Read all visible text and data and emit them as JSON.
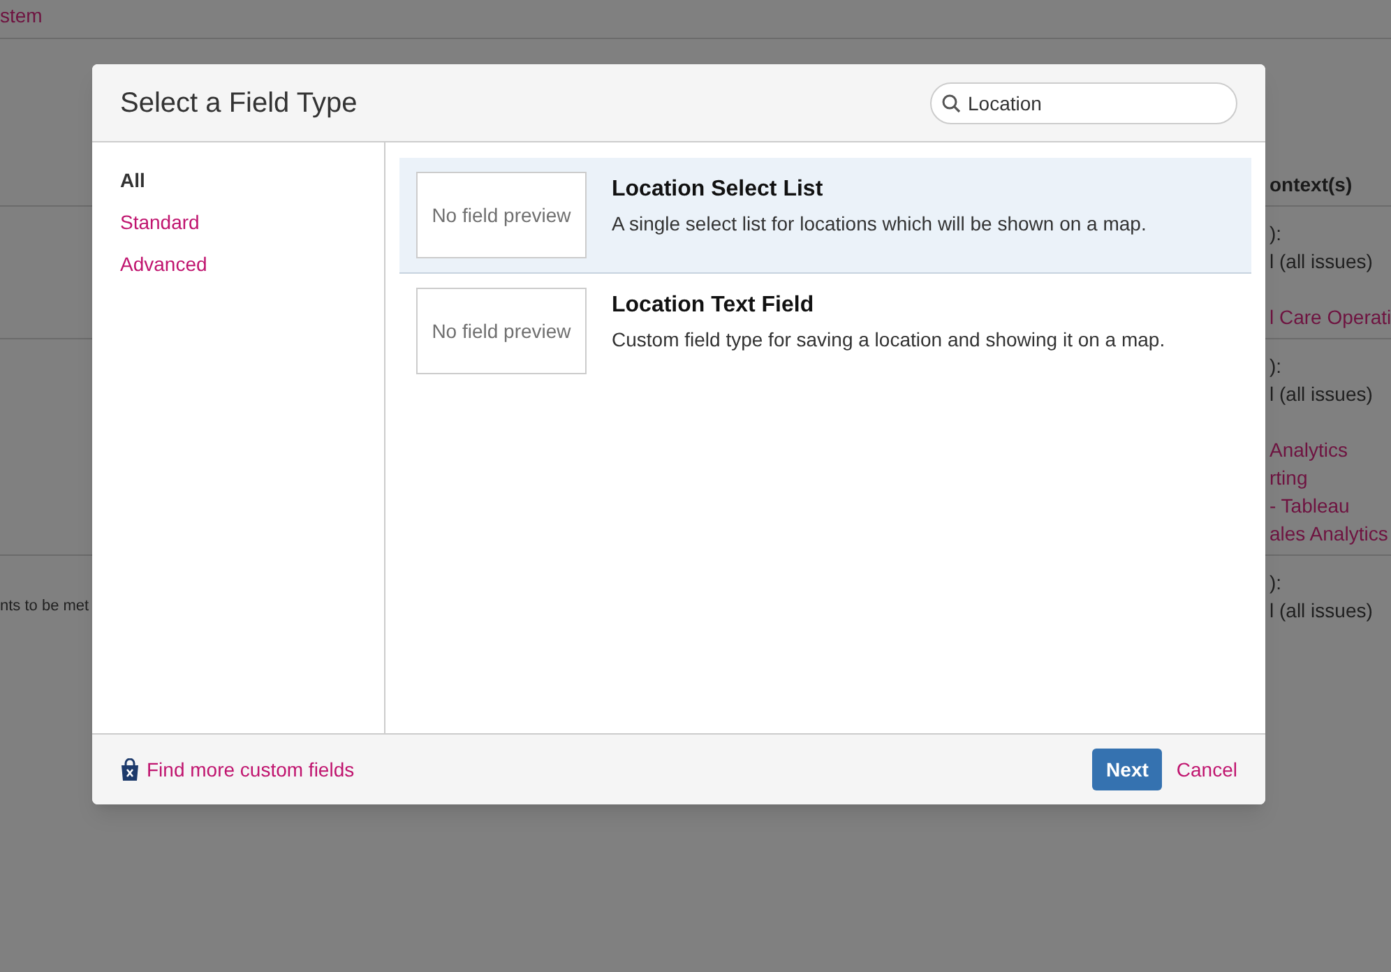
{
  "background": {
    "texts": [
      {
        "text": "stem",
        "kind": "link"
      },
      {
        "text": "nts to be met",
        "kind": "plain"
      },
      {
        "text": "ontext(s)",
        "kind": "heading"
      },
      {
        "text": "):",
        "kind": "plain"
      },
      {
        "text": "l (all issues)",
        "kind": "plain"
      },
      {
        "text": "l Care Operati",
        "kind": "link"
      },
      {
        "text": "):",
        "kind": "plain"
      },
      {
        "text": "l (all issues)",
        "kind": "plain"
      },
      {
        "text": "Analytics",
        "kind": "link"
      },
      {
        "text": "rting",
        "kind": "link"
      },
      {
        "text": "- Tableau",
        "kind": "link"
      },
      {
        "text": "ales Analytics",
        "kind": "link"
      },
      {
        "text": "):",
        "kind": "plain"
      },
      {
        "text": "l (all issues)",
        "kind": "plain"
      }
    ]
  },
  "dialog": {
    "title": "Select a Field Type",
    "search": {
      "value": "Location"
    },
    "categories": [
      {
        "label": "All",
        "selected": true
      },
      {
        "label": "Standard",
        "selected": false
      },
      {
        "label": "Advanced",
        "selected": false
      }
    ],
    "field_types": [
      {
        "name": "Location Select List",
        "description": "A single select list for locations which will be shown on a map.",
        "preview": "No field preview",
        "selected": true
      },
      {
        "name": "Location Text Field",
        "description": "Custom field type for saving a location and showing it on a map.",
        "preview": "No field preview",
        "selected": false
      }
    ],
    "footer_link": "Find more custom fields",
    "buttons": [
      {
        "label": "Next",
        "kind": "primary"
      },
      {
        "label": "Cancel",
        "kind": "link"
      }
    ]
  }
}
